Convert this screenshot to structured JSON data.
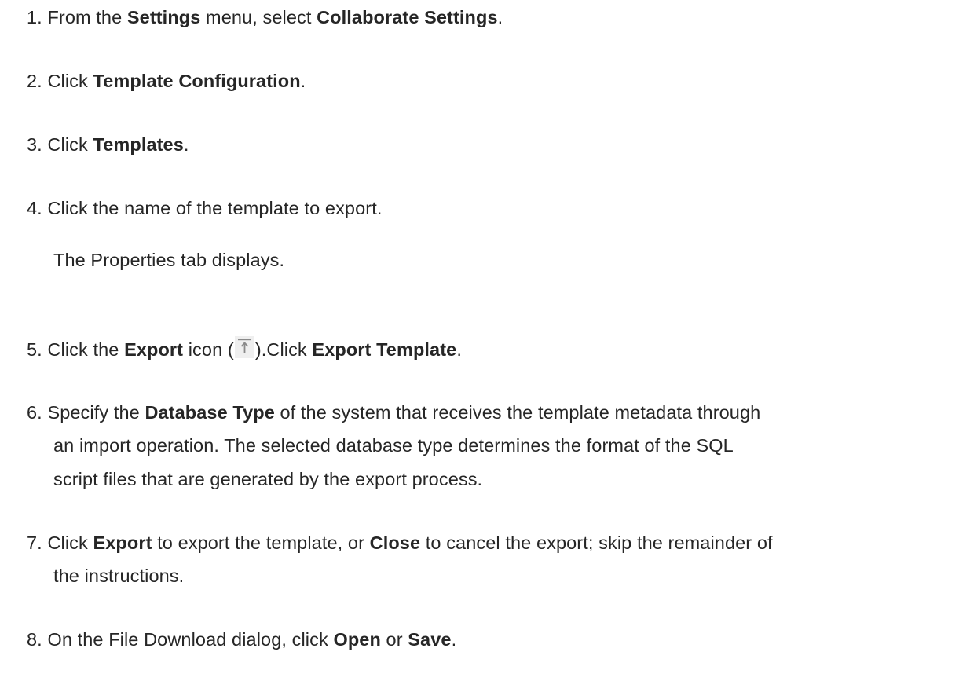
{
  "steps": [
    {
      "number": "1. ",
      "t1": "From the ",
      "b1": "Settings",
      "t2": " menu, select ",
      "b2": "Collaborate Settings",
      "t3": "."
    },
    {
      "number": "2. ",
      "t1": "Click ",
      "b1": "Template Configuration",
      "t2": "."
    },
    {
      "number": "3. ",
      "t1": "Click ",
      "b1": "Templates",
      "t2": "."
    },
    {
      "number": "4. ",
      "t1": "Click the name of the template to export.",
      "sub": "The Properties tab displays."
    },
    {
      "number": "5. ",
      "t1": "Click the ",
      "b1": "Export",
      "t2": " icon (",
      "icon": "export-upload-icon",
      "t3": ").Click ",
      "b2": "Export Template",
      "t4": "."
    },
    {
      "number": "6. ",
      "t1": "Specify the ",
      "b1": "Database Type",
      "t2": " of the system that receives the template metadata through",
      "l2": "an import operation. The selected database type determines the format of the SQL",
      "l3": "script files that are generated by the export process."
    },
    {
      "number": "7. ",
      "t1": "Click ",
      "b1": "Export",
      "t2": " to export the template, or ",
      "b2": "Close",
      "t3": " to cancel the export; skip the remainder of",
      "l2": "the instructions."
    },
    {
      "number": "8. ",
      "t1": "On the File Download dialog, click ",
      "b1": "Open",
      "t2": " or ",
      "b2": "Save",
      "t3": "."
    }
  ],
  "colors": {
    "text": "#262626",
    "icon_bg": "#efefef",
    "icon_fg": "#8a8a8a"
  }
}
